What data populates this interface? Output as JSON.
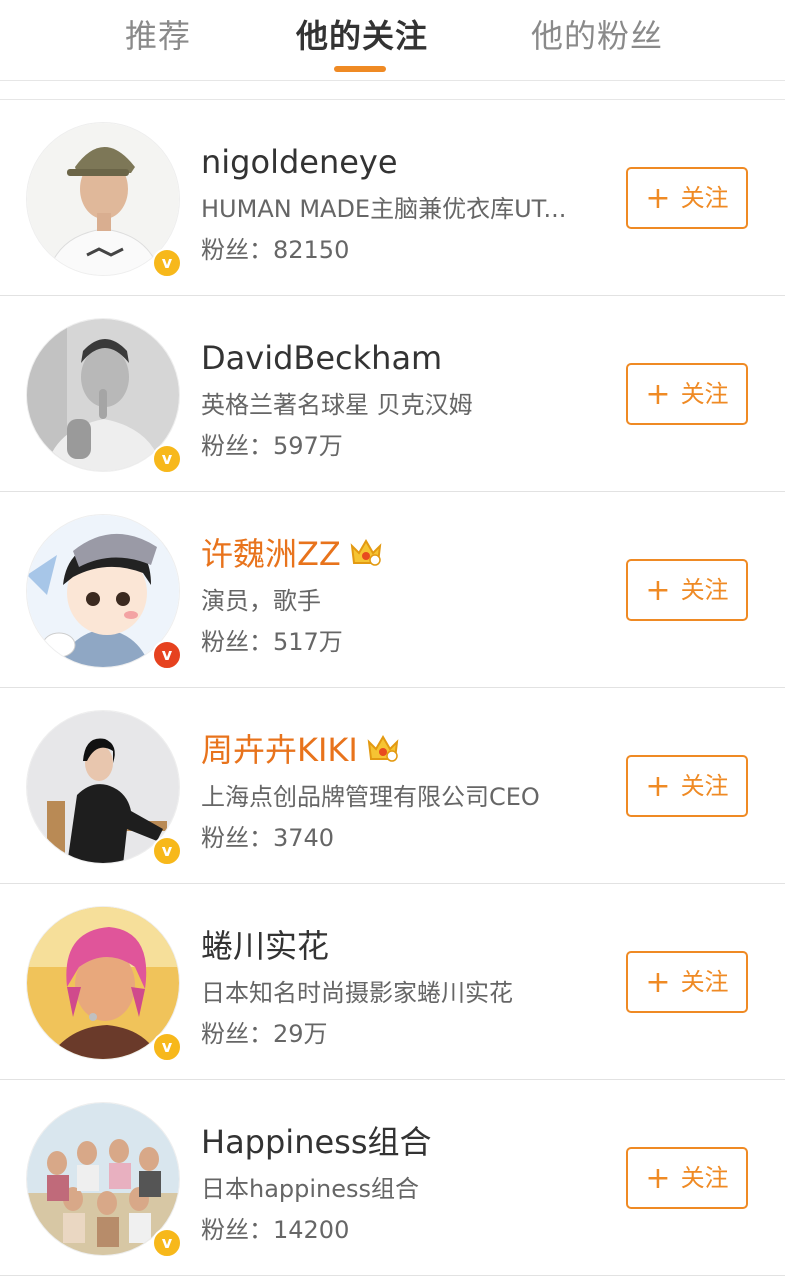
{
  "tabs": [
    {
      "label": "推荐",
      "active": false
    },
    {
      "label": "他的关注",
      "active": true
    },
    {
      "label": "他的粉丝",
      "active": false
    }
  ],
  "accent_color": "#ef8a24",
  "follow_label": "关注",
  "users": [
    {
      "name": "nigoldeneye",
      "vip": false,
      "desc": "HUMAN MADE主脑兼优衣库UT...",
      "fans": "粉丝：82150",
      "badge": "yellow-v"
    },
    {
      "name": "DavidBeckham",
      "vip": false,
      "desc": "英格兰著名球星 贝克汉姆",
      "fans": "粉丝：597万",
      "badge": "yellow-v"
    },
    {
      "name": "许魏洲ZZ",
      "vip": true,
      "desc": "演员，歌手",
      "fans": "粉丝：517万",
      "badge": "red-v"
    },
    {
      "name": "周卉卉KIKI",
      "vip": true,
      "desc": "上海点创品牌管理有限公司CEO",
      "fans": "粉丝：3740",
      "badge": "yellow-v"
    },
    {
      "name": "蜷川实花",
      "vip": false,
      "desc": "日本知名时尚摄影家蜷川实花",
      "fans": "粉丝：29万",
      "badge": "yellow-v"
    },
    {
      "name": "Happiness组合",
      "vip": false,
      "desc": "日本happiness组合",
      "fans": "粉丝：14200",
      "badge": "yellow-v"
    }
  ]
}
